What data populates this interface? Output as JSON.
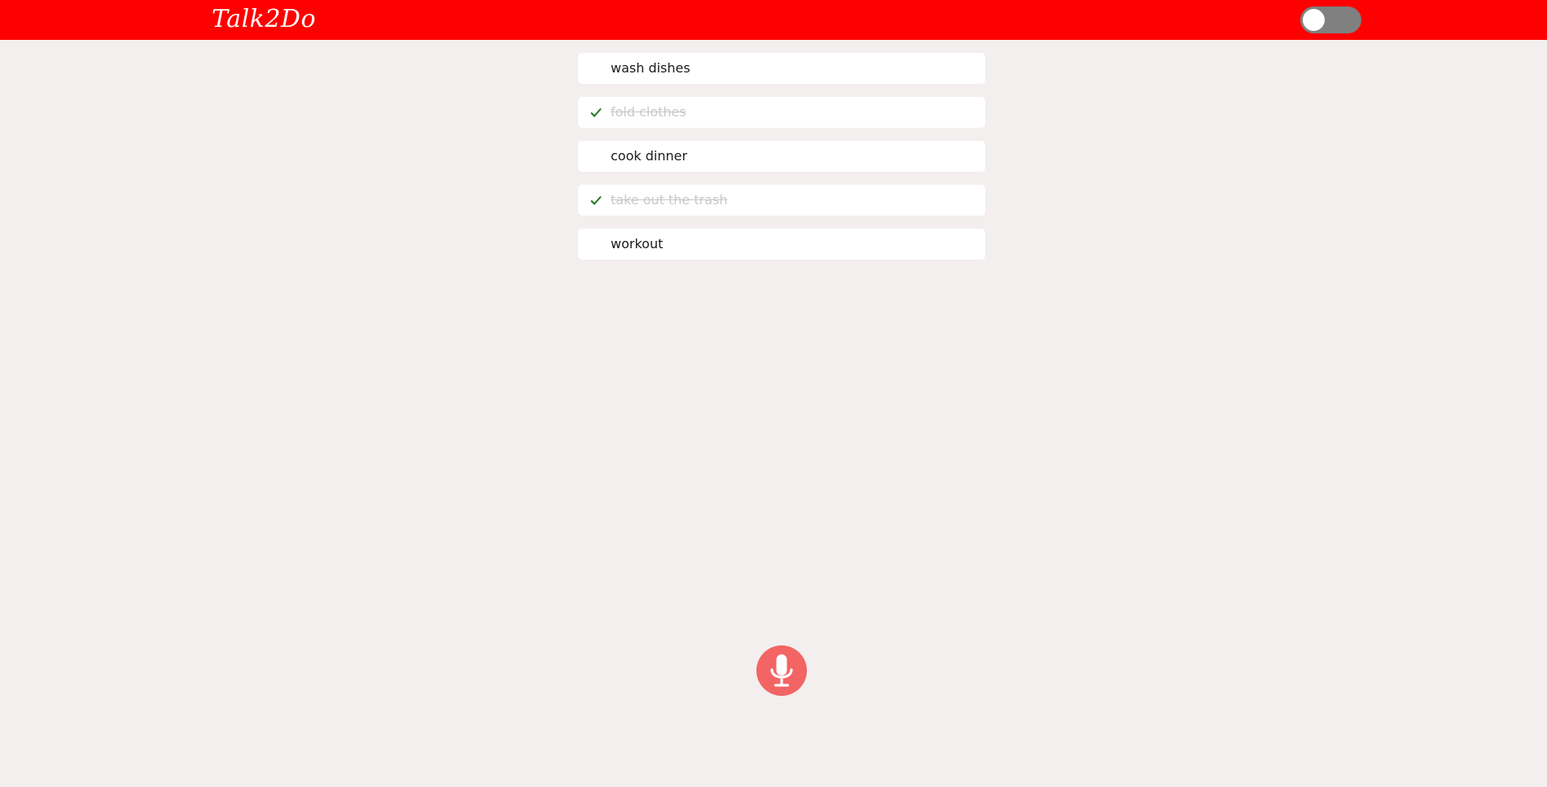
{
  "header": {
    "logo_text": "Talk2Do",
    "theme_toggle": {
      "state": "off"
    }
  },
  "colors": {
    "header_bg": "#ff0000",
    "page_bg": "#f3efee",
    "toggle_bg": "#808080",
    "check": "#1e7a1e",
    "done_text": "#c8c8c8",
    "mic_button": "#f36464"
  },
  "todos": [
    {
      "text": "wash dishes",
      "done": false
    },
    {
      "text": "fold clothes",
      "done": true
    },
    {
      "text": "cook dinner",
      "done": false
    },
    {
      "text": "take out the trash",
      "done": true
    },
    {
      "text": "workout",
      "done": false
    }
  ],
  "icons": {
    "check": "check-icon",
    "mic": "microphone-icon"
  }
}
